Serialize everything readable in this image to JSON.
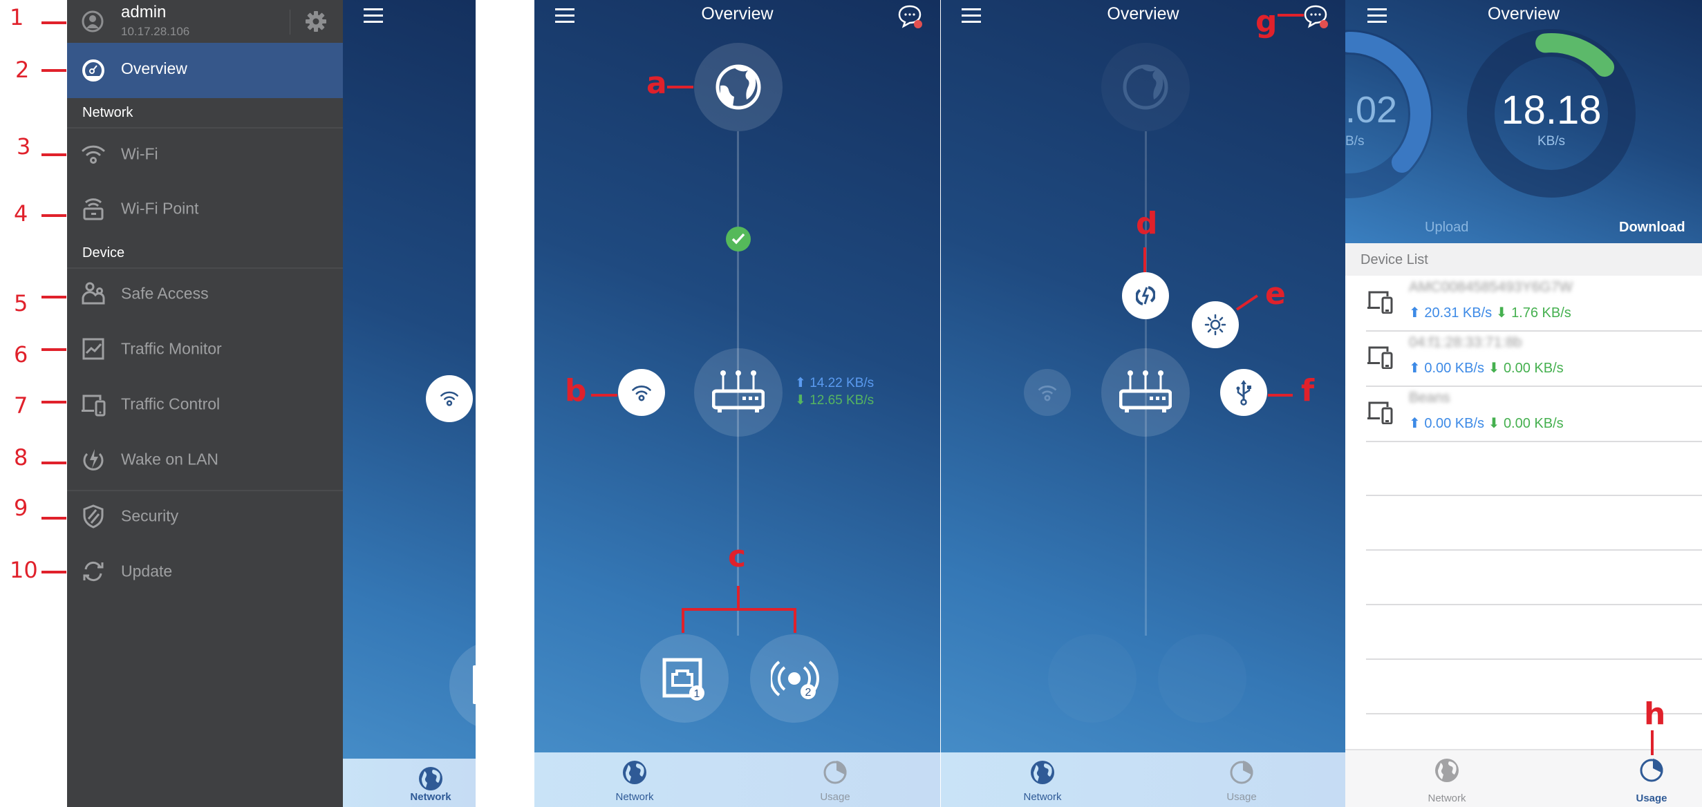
{
  "annotations": {
    "numbers": [
      "1",
      "2",
      "3",
      "4",
      "5",
      "6",
      "7",
      "8",
      "9",
      "10"
    ],
    "letters": {
      "a": "a",
      "b": "b",
      "c": "c",
      "d": "d",
      "e": "e",
      "f": "f",
      "g": "g",
      "h": "h"
    },
    "color": "#e0212b"
  },
  "sidebar": {
    "user": {
      "name": "admin",
      "ip": "10.17.28.106",
      "icon": "user-avatar-icon",
      "settings_icon": "gear-icon"
    },
    "active_item": {
      "label": "Overview",
      "icon": "gauge-icon"
    },
    "sections": [
      {
        "title": "Network",
        "items": [
          {
            "label": "Wi-Fi",
            "icon": "wifi-icon"
          },
          {
            "label": "Wi-Fi Point",
            "icon": "wifi-point-icon"
          }
        ]
      },
      {
        "title": "Device",
        "items": [
          {
            "label": "Safe Access",
            "icon": "users-icon"
          },
          {
            "label": "Traffic Monitor",
            "icon": "chart-icon"
          },
          {
            "label": "Traffic Control",
            "icon": "devices-icon"
          },
          {
            "label": "Wake on LAN",
            "icon": "power-bolt-icon"
          }
        ]
      },
      {
        "title": "",
        "items": [
          {
            "label": "Security",
            "icon": "shield-icon"
          },
          {
            "label": "Update",
            "icon": "refresh-icon"
          }
        ]
      }
    ],
    "colors": {
      "background": "#3f4042",
      "active": "#36578a"
    }
  },
  "screens": {
    "title": "Overview",
    "tabs": {
      "network": "Network",
      "usage": "Usage"
    },
    "network": {
      "upload_speed": "14.22 KB/s",
      "download_speed": "12.65 KB/s",
      "ethernet_count": "1",
      "wireless_count": "2"
    },
    "usage": {
      "upload_value_partial": ".02",
      "upload_unit_partial": "B/s",
      "download_value": "18.18",
      "download_unit": "KB/s",
      "upload_label": "Upload",
      "download_label": "Download",
      "download_gauge_fraction": 0.15,
      "device_list_title": "Device List",
      "devices": [
        {
          "name": "AMC0084585493Y6G7W",
          "up": "20.31 KB/s",
          "down": "1.76 KB/s"
        },
        {
          "name": "04:f1:28:33:71:8b",
          "up": "0.00 KB/s",
          "down": "0.00 KB/s"
        },
        {
          "name": "Beans",
          "up": "0.00 KB/s",
          "down": "0.00 KB/s"
        }
      ]
    },
    "colors": {
      "upload": "#5b9bf0",
      "download": "#56b560",
      "gauge": "#5cb96a",
      "badge": "#e25050"
    }
  }
}
